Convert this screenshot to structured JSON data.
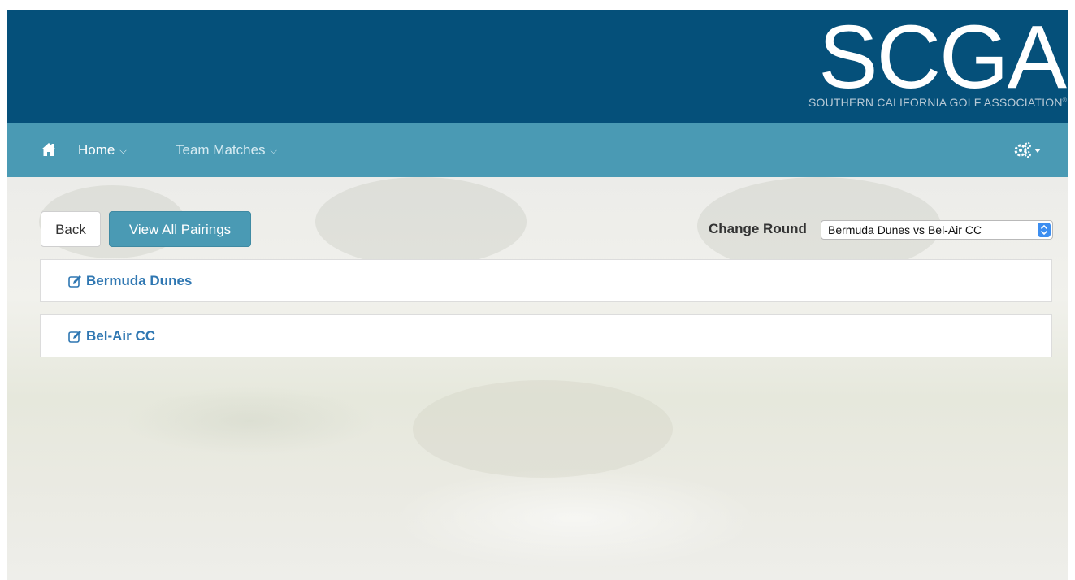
{
  "header": {
    "logo_text": "SCGA",
    "logo_subtitle": "SOUTHERN CALIFORNIA GOLF ASSOCIATION",
    "logo_registered": "®",
    "colors": {
      "background": "#05507a"
    }
  },
  "navbar": {
    "home_icon": "home-icon",
    "items": [
      {
        "label": "Home",
        "icon": "chevron-down-icon"
      },
      {
        "label": "Team Matches",
        "icon": "chevron-down-icon"
      }
    ],
    "settings_icon": "gears-icon",
    "colors": {
      "background": "#4a9ab4"
    }
  },
  "toolbar": {
    "back_label": "Back",
    "view_all_pairings_label": "View All Pairings",
    "change_round_label": "Change Round",
    "round_select_value": "Bermuda Dunes vs Bel-Air CC"
  },
  "teams": [
    {
      "name": "Bermuda Dunes",
      "icon": "edit-icon"
    },
    {
      "name": "Bel-Air CC",
      "icon": "edit-icon"
    }
  ],
  "colors": {
    "link": "#2f77b2",
    "primary_button": "#4a9ab4"
  }
}
